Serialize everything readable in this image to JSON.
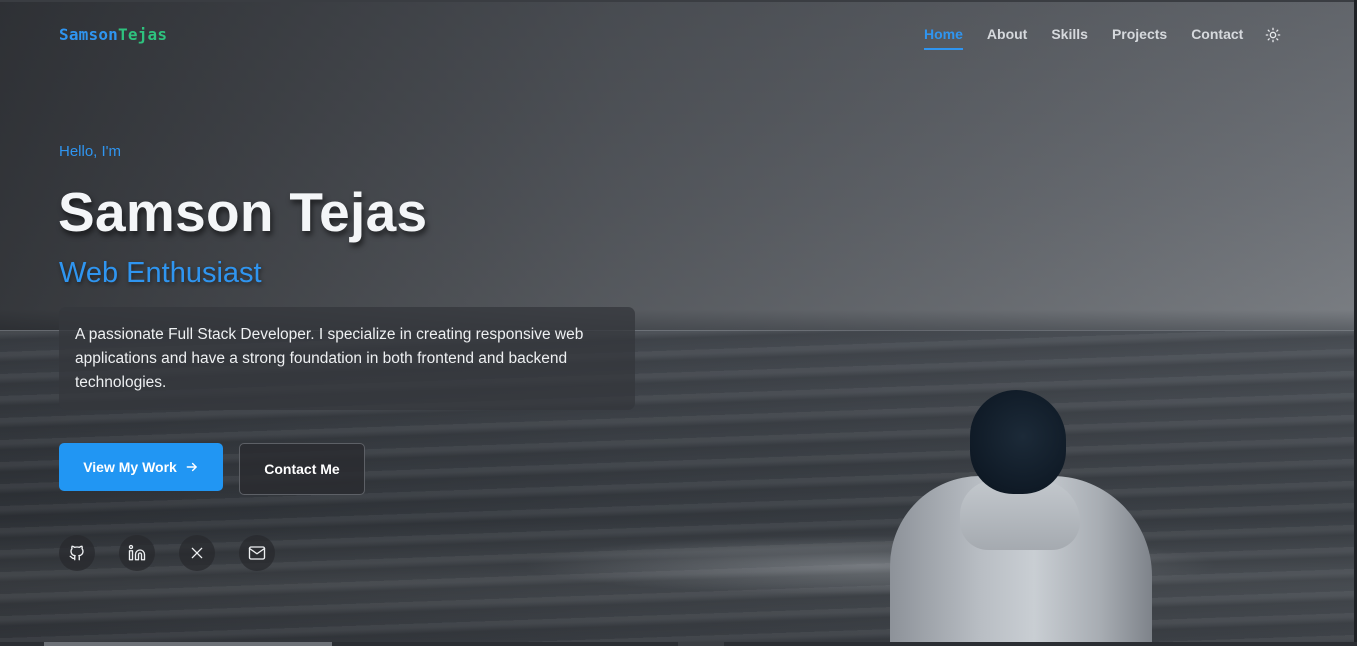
{
  "brand": {
    "part1": "Samson",
    "part2": "Tejas"
  },
  "nav": {
    "items": [
      {
        "label": "Home",
        "active": true
      },
      {
        "label": "About",
        "active": false
      },
      {
        "label": "Skills",
        "active": false
      },
      {
        "label": "Projects",
        "active": false
      },
      {
        "label": "Contact",
        "active": false
      }
    ],
    "theme_toggle_icon": "sun-icon"
  },
  "hero": {
    "greeting": "Hello, I'm",
    "name": "Samson Tejas",
    "role": "Web Enthusiast",
    "bio": "A passionate Full Stack Developer. I specialize in creating responsive web applications and have a strong foundation in both frontend and backend technologies.",
    "primary_button": "View My Work",
    "secondary_button": "Contact Me"
  },
  "socials": [
    {
      "icon": "github-icon"
    },
    {
      "icon": "linkedin-icon"
    },
    {
      "icon": "x-icon"
    },
    {
      "icon": "mail-icon"
    }
  ],
  "colors": {
    "accent": "#2196f3",
    "brand_green": "#2ec27e",
    "text_light": "#f4f6f8"
  }
}
